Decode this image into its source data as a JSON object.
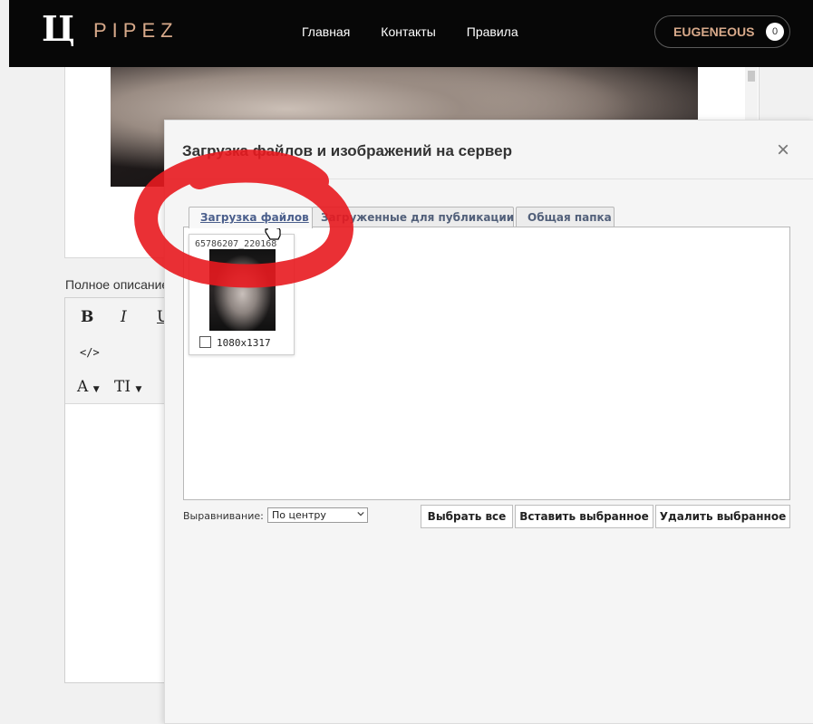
{
  "header": {
    "logo_mark": "Ц",
    "logo_text": "PIPEZ",
    "nav": [
      "Главная",
      "Контакты",
      "Правила"
    ],
    "user": {
      "name": "EUGENEOUS",
      "count": "0"
    }
  },
  "editor": {
    "description_label": "Полное описание",
    "toolbar": {
      "bold": "B",
      "italic": "I",
      "underline": "U",
      "code": "</>",
      "font_color": "A",
      "font_size": "TI"
    }
  },
  "modal": {
    "title": "Загрузка файлов и изображений на сервер",
    "close": "×",
    "tabs": [
      {
        "label": "Загрузка файлов",
        "active": true
      },
      {
        "label": "Загруженные для публикации",
        "active": false
      },
      {
        "label": "Общая папка",
        "active": false
      }
    ],
    "file": {
      "name": "65786207_220168",
      "dims": "1080x1317",
      "checked": false
    },
    "align_label": "Выравнивание:",
    "align_value": "По центру",
    "buttons": {
      "select_all": "Выбрать все",
      "insert_selected": "Вставить выбранное",
      "delete_selected": "Удалить выбранное"
    }
  },
  "annotation": {
    "color": "#e8191f",
    "shape": "hand-drawn circle"
  }
}
